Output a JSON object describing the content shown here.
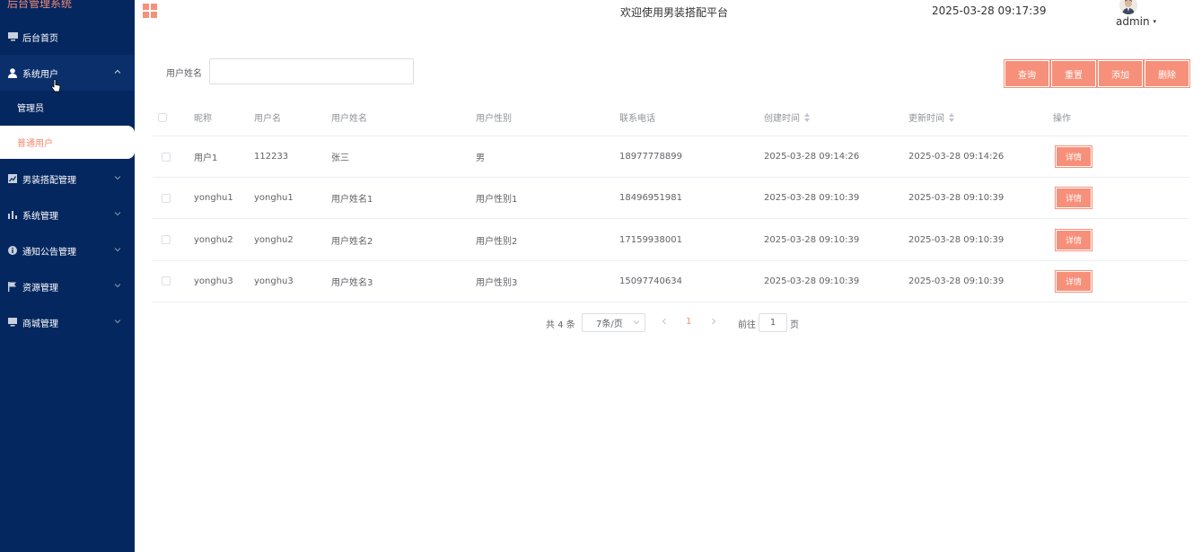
{
  "app": {
    "title": "后台管理系统"
  },
  "colors": {
    "sidebar_bg": "#05275f",
    "accent": "#f7907a",
    "active_text": "#f28a6e"
  },
  "sidebar": {
    "items": [
      {
        "label": "后台首页",
        "icon": "monitor-icon"
      },
      {
        "label": "系统用户",
        "icon": "user-icon",
        "open": true,
        "children": [
          {
            "label": "管理员"
          },
          {
            "label": "普通用户",
            "active": true
          }
        ]
      },
      {
        "label": "男装搭配管理",
        "icon": "chart-icon"
      },
      {
        "label": "系统管理",
        "icon": "bar-chart-icon"
      },
      {
        "label": "通知公告管理",
        "icon": "info-icon"
      },
      {
        "label": "资源管理",
        "icon": "flag-icon"
      },
      {
        "label": "商城管理",
        "icon": "monitor-icon"
      }
    ]
  },
  "header": {
    "welcome": "欢迎使用男装搭配平台",
    "clock": "2025-03-28 09:17:39",
    "user": "admin"
  },
  "search": {
    "label": "用户姓名",
    "value": ""
  },
  "toolbar": {
    "query": "查询",
    "reset": "重置",
    "add": "添加",
    "delete": "删除"
  },
  "table": {
    "columns": [
      "昵称",
      "用户名",
      "用户姓名",
      "用户性别",
      "联系电话",
      "创建时间",
      "更新时间",
      "操作"
    ],
    "detail_label": "详情",
    "rows": [
      [
        "用户1",
        "112233",
        "张三",
        "男",
        "18977778899",
        "2025-03-28 09:14:26",
        "2025-03-28 09:14:26"
      ],
      [
        "yonghu1",
        "yonghu1",
        "用户姓名1",
        "用户性别1",
        "18496951981",
        "2025-03-28 09:10:39",
        "2025-03-28 09:10:39"
      ],
      [
        "yonghu2",
        "yonghu2",
        "用户姓名2",
        "用户性别2",
        "17159938001",
        "2025-03-28 09:10:39",
        "2025-03-28 09:10:39"
      ],
      [
        "yonghu3",
        "yonghu3",
        "用户姓名3",
        "用户性别3",
        "15097740634",
        "2025-03-28 09:10:39",
        "2025-03-28 09:10:39"
      ]
    ]
  },
  "pagination": {
    "total": "共 4 条",
    "page_size": "7条/页",
    "current": "1",
    "goto_label": "前往",
    "goto_value": "1",
    "page_suffix": "页"
  }
}
